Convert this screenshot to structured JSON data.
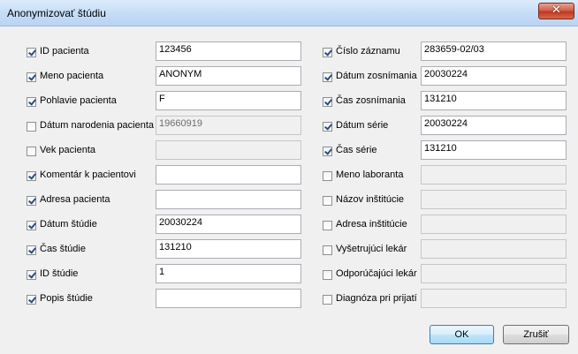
{
  "window": {
    "title": "Anonymizovať štúdiu",
    "close_symbol": "✕"
  },
  "left_column": [
    {
      "label": "ID pacienta",
      "checked": true,
      "value": "123456",
      "enabled": true
    },
    {
      "label": "Meno pacienta",
      "checked": true,
      "value": "ANONYM",
      "enabled": true
    },
    {
      "label": "Pohlavie pacienta",
      "checked": true,
      "value": "F",
      "enabled": true
    },
    {
      "label": "Dátum narodenia pacienta",
      "checked": false,
      "value": "19660919",
      "enabled": false
    },
    {
      "label": "Vek pacienta",
      "checked": false,
      "value": "",
      "enabled": false
    },
    {
      "label": "Komentár k pacientovi",
      "checked": true,
      "value": "",
      "enabled": true
    },
    {
      "label": "Adresa pacienta",
      "checked": true,
      "value": "",
      "enabled": true
    },
    {
      "label": "Dátum štúdie",
      "checked": true,
      "value": "20030224",
      "enabled": true
    },
    {
      "label": "Čas štúdie",
      "checked": true,
      "value": "131210",
      "enabled": true
    },
    {
      "label": "ID štúdie",
      "checked": true,
      "value": "1",
      "enabled": true
    },
    {
      "label": "Popis štúdie",
      "checked": true,
      "value": "",
      "enabled": true
    }
  ],
  "right_column": [
    {
      "label": "Číslo záznamu",
      "checked": true,
      "value": "283659-02/03",
      "enabled": true
    },
    {
      "label": "Dátum zosnímania",
      "checked": true,
      "value": "20030224",
      "enabled": true
    },
    {
      "label": "Čas zosnímania",
      "checked": true,
      "value": "131210",
      "enabled": true
    },
    {
      "label": "Dátum série",
      "checked": true,
      "value": "20030224",
      "enabled": true
    },
    {
      "label": "Čas série",
      "checked": true,
      "value": "131210",
      "enabled": true
    },
    {
      "label": "Meno laboranta",
      "checked": false,
      "value": "",
      "enabled": false
    },
    {
      "label": "Názov inštitúcie",
      "checked": false,
      "value": "",
      "enabled": false
    },
    {
      "label": "Adresa inštitúcie",
      "checked": false,
      "value": "",
      "enabled": false
    },
    {
      "label": "Vyšetrujúci lekár",
      "checked": false,
      "value": "",
      "enabled": false
    },
    {
      "label": "Odporúčajúci lekár",
      "checked": false,
      "value": "",
      "enabled": false
    },
    {
      "label": "Diagnóza pri prijatí",
      "checked": false,
      "value": "",
      "enabled": false
    }
  ],
  "buttons": {
    "ok_label": "OK",
    "cancel_label": "Zrušiť"
  }
}
